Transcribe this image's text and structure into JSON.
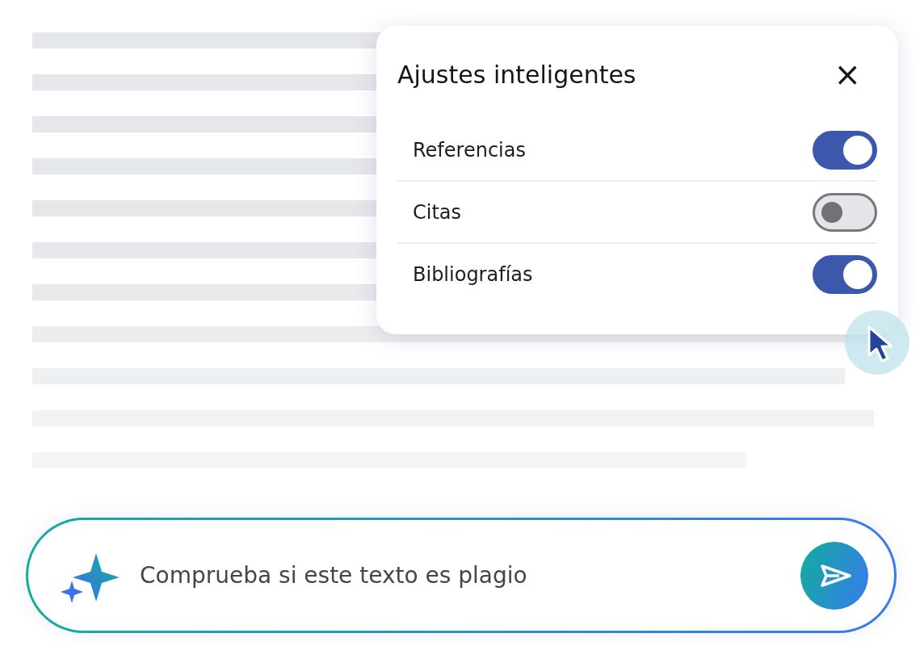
{
  "settings_panel": {
    "title": "Ajustes inteligentes",
    "close": "×",
    "options": [
      {
        "label": "Referencias",
        "on": true
      },
      {
        "label": "Citas",
        "on": false
      },
      {
        "label": "Bibliografías",
        "on": true
      }
    ]
  },
  "prompt": {
    "value": "Comprueba si este texto es plagio"
  }
}
